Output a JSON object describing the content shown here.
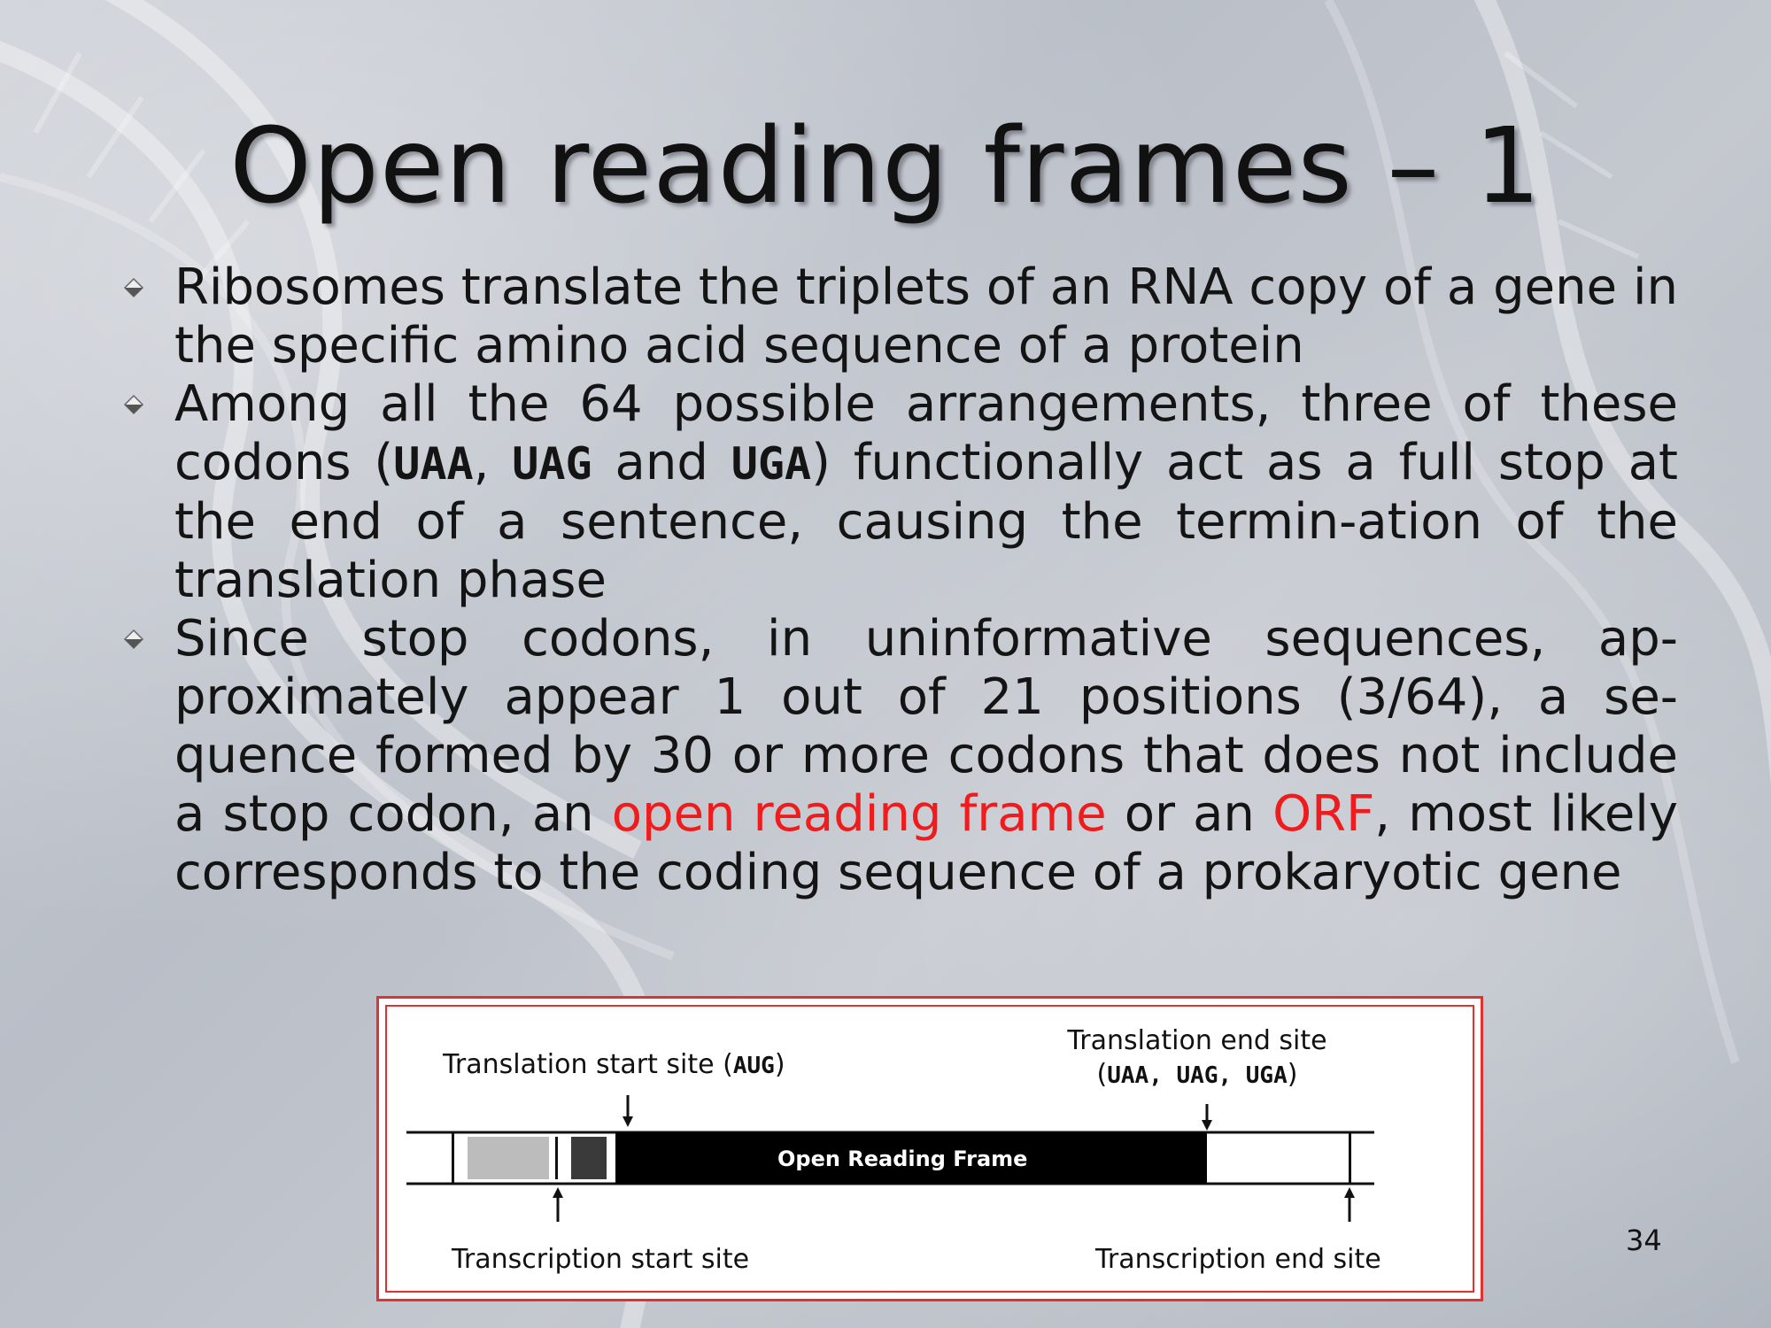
{
  "slide": {
    "title": "Open reading frames – 1",
    "page_number": "34"
  },
  "bullets": [
    {
      "text": "Ribosomes translate the triplets of an RNA copy of a gene in the specific amino acid sequence of a protein"
    },
    {
      "part1": "Among all the 64 possible arrangements, three of these codons (",
      "codon1": "UAA",
      "sep1": ", ",
      "codon2": "UAG",
      "sep2": " and ",
      "codon3": "UGA",
      "part2": ") functionally act as a full stop at the end of a sentence, causing the termin-ation of the translation phase"
    },
    {
      "part1": "Since stop codons, in uninformative sequences, ap-proximately appear 1 out of 21 positions (3/64), a se-quence formed by 30 or more codons that does not include a stop codon, an ",
      "highlight1": "open reading frame",
      "part2": " or an ",
      "highlight2": "ORF",
      "part3": ", most likely corresponds to the coding sequence of a prokaryotic gene"
    }
  ],
  "figure": {
    "translation_start_label": "Translation start site (",
    "translation_start_codon": "AUG",
    "translation_start_close": ")",
    "translation_end_label": "Translation end site",
    "translation_end_open": "(",
    "translation_end_codons": "UAA, UAG, UGA",
    "translation_end_close": ")",
    "orf_label": "Open Reading Frame",
    "transcription_start_label": "Transcription start site",
    "transcription_end_label": "Transcription end site"
  },
  "colors": {
    "highlight": "#ee1c1c",
    "figure_border": "#e53030"
  }
}
